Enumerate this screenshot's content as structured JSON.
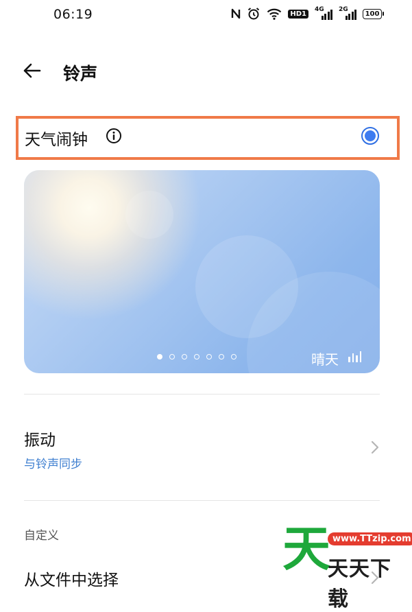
{
  "status_bar": {
    "time": "06:19",
    "icons": [
      "nfc-icon",
      "alarm-icon",
      "wifi-icon",
      "hd-icon",
      "signal-4g-icon",
      "signal-2g-icon",
      "battery-icon"
    ],
    "hd_label": "HD1",
    "net1": "4G",
    "net2": "2G",
    "battery": "100"
  },
  "header": {
    "title": "铃声"
  },
  "selected_option": {
    "label": "天气闹钟",
    "selected": true,
    "highlight_color": "#f07a48",
    "radio_color": "#3e7cf0"
  },
  "preview": {
    "weather": "晴天",
    "page_count": 7,
    "active_page": 0
  },
  "vibration": {
    "title": "振动",
    "subtitle": "与铃声同步"
  },
  "custom_section": {
    "header": "自定义",
    "item": "从文件中选择"
  },
  "watermark": {
    "glyph": "天",
    "url": "www.TTzip.com",
    "text": "天天下载"
  }
}
